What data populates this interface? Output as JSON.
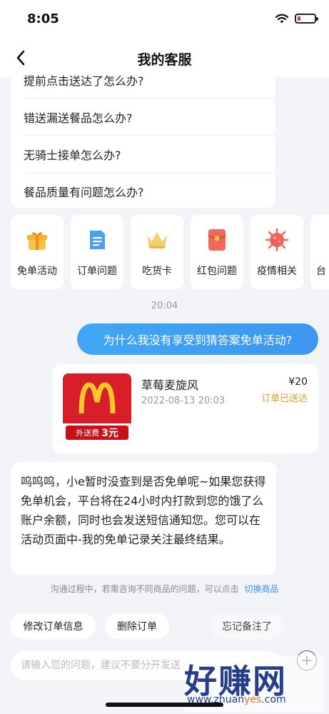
{
  "status_bar": {
    "time": "8:05"
  },
  "nav": {
    "title": "我的客服"
  },
  "faq": [
    "提前点击送达了怎么办?",
    "错送漏送餐品怎么办?",
    "无骑士接单怎么办?",
    "餐品质量有问题怎么办?"
  ],
  "quick_entries": [
    {
      "label": "免单活动",
      "icon": "gift-icon"
    },
    {
      "label": "订单问题",
      "icon": "document-icon"
    },
    {
      "label": "吃货卡",
      "icon": "crown-icon"
    },
    {
      "label": "红包问题",
      "icon": "red-envelope-icon"
    },
    {
      "label": "疫情相关",
      "icon": "virus-icon"
    },
    {
      "label": "台",
      "icon": "partial-card"
    }
  ],
  "chat": {
    "time": "20:04",
    "user_message": "为什么我没有享受到猜答案免单活动?",
    "order": {
      "name": "草莓麦旋风",
      "date": "2022-08-13 20:03",
      "price": "¥20",
      "status": "订单已送达",
      "thumb_prefix": "外送费",
      "thumb_value": "3元"
    },
    "bot_message": "呜呜呜，小e暂时没查到是否免单呢~如果您获得免单机会，平台将在24小时内打款到您的饿了么账户余额，同时也会发送短信通知您。您可以在活动页面中-我的免单记录关注最终结果。"
  },
  "hint": {
    "text": "沟通过程中，若需咨询不同商品的问题，可以点击",
    "link": "切换商品"
  },
  "actions": {
    "modify": "修改订单信息",
    "delete": "删除订单",
    "forgot": "忘记备注了"
  },
  "input": {
    "placeholder": "请输入您的问题，建议不要分开发送"
  },
  "watermark": {
    "main": "好赚网",
    "sub_prefix": "www.zhuan",
    "sub_accent": "yes",
    "sub_suffix": ".com"
  },
  "colors": {
    "accent_blue": "#3d96f0",
    "status_orange": "#e09a2c",
    "brand_red": "#d81e28"
  }
}
